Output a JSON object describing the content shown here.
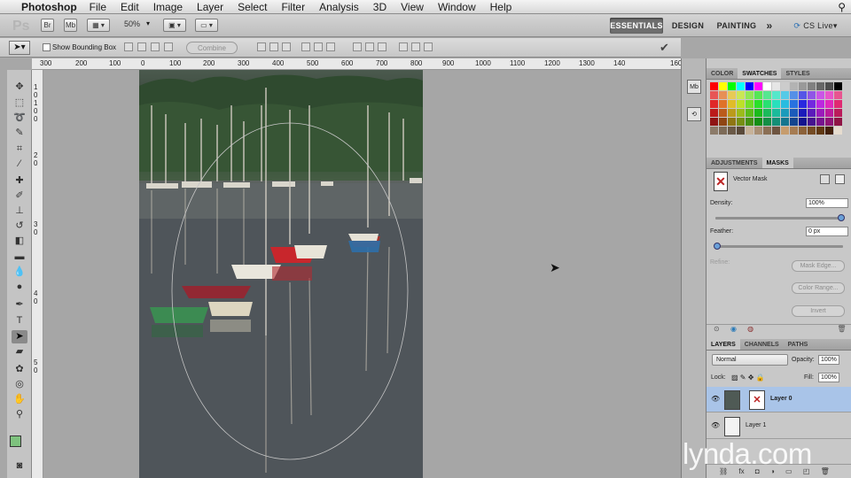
{
  "menubar": {
    "app": "Photoshop",
    "items": [
      "File",
      "Edit",
      "Image",
      "Layer",
      "Select",
      "Filter",
      "Analysis",
      "3D",
      "View",
      "Window",
      "Help"
    ]
  },
  "appbar": {
    "logo": "Ps",
    "zoom": "50%",
    "workspaces": [
      "ESSENTIALS",
      "DESIGN",
      "PAINTING"
    ],
    "more": "»",
    "cs_live": "CS Live"
  },
  "options": {
    "show_bounding_box": "Show Bounding Box",
    "combine": "Combine"
  },
  "ruler": {
    "top_labels": [
      "300",
      "200",
      "100",
      "0",
      "100",
      "200",
      "300",
      "400",
      "500",
      "600",
      "700",
      "800",
      "900",
      "1000",
      "1100",
      "1200",
      "1300",
      "140",
      "160"
    ],
    "left_labels": [
      "1",
      "0",
      "1",
      "0",
      "0",
      "2",
      "0",
      "3",
      "0",
      "4",
      "0",
      "5",
      "0"
    ]
  },
  "panels": {
    "top_tabs": [
      "COLOR",
      "SWATCHES",
      "STYLES"
    ],
    "mid_tabs": [
      "ADJUSTMENTS",
      "MASKS"
    ],
    "masks": {
      "title": "Vector Mask",
      "density_label": "Density:",
      "density_value": "100%",
      "feather_label": "Feather:",
      "feather_value": "0 px",
      "refine_label": "Refine:",
      "mask_edge": "Mask Edge...",
      "color_range": "Color Range...",
      "invert": "Invert"
    },
    "layer_tabs": [
      "LAYERS",
      "CHANNELS",
      "PATHS"
    ],
    "layers": {
      "blend_mode": "Normal",
      "opacity_label": "Opacity:",
      "opacity_value": "100%",
      "lock_label": "Lock:",
      "fill_label": "Fill:",
      "fill_value": "100%",
      "items": [
        {
          "name": "Layer 0",
          "selected": true
        },
        {
          "name": "Layer 1",
          "selected": false
        }
      ]
    }
  },
  "watermark": "lynda.com",
  "colors": {
    "foreground": "#7ec27e",
    "background": "#ffffff",
    "selected_layer": "#a9c4e8"
  }
}
